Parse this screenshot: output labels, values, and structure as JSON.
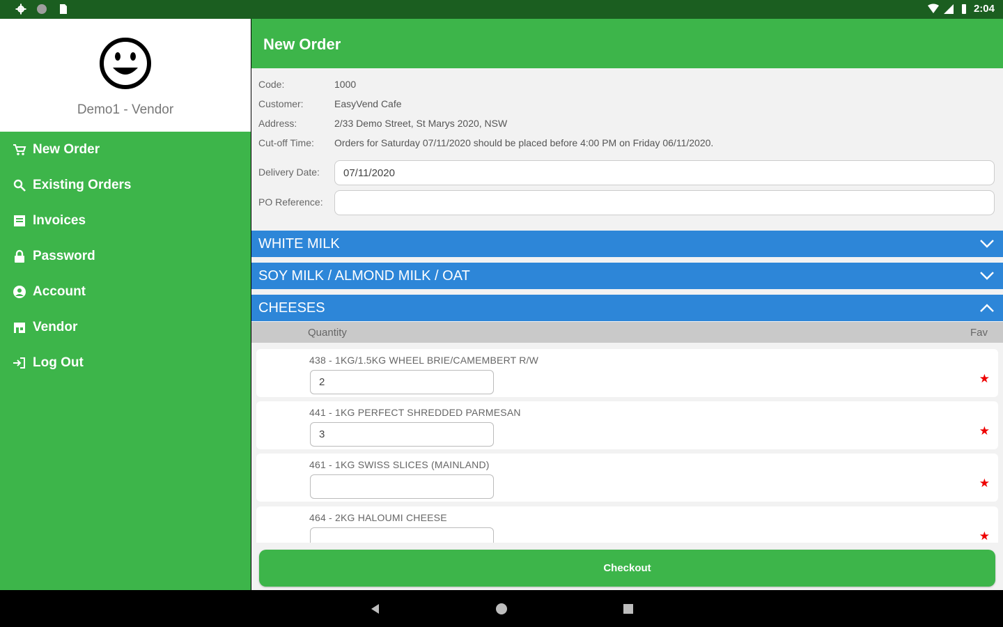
{
  "status_bar": {
    "time": "2:04"
  },
  "sidebar": {
    "profile_name": "Demo1 - Vendor",
    "items": [
      {
        "label": "New Order",
        "icon": "cart-icon"
      },
      {
        "label": "Existing Orders",
        "icon": "search-icon"
      },
      {
        "label": "Invoices",
        "icon": "invoice-icon"
      },
      {
        "label": "Password",
        "icon": "lock-icon"
      },
      {
        "label": "Account",
        "icon": "account-icon"
      },
      {
        "label": "Vendor",
        "icon": "store-icon"
      },
      {
        "label": "Log Out",
        "icon": "logout-icon"
      }
    ]
  },
  "header": {
    "title": "New Order"
  },
  "order_info": {
    "code_label": "Code:",
    "code": "1000",
    "customer_label": "Customer:",
    "customer": "EasyVend Cafe",
    "address_label": "Address:",
    "address": "2/33 Demo Street, St Marys 2020, NSW",
    "cutoff_label": "Cut-off Time:",
    "cutoff": "Orders for Saturday 07/11/2020 should be placed before 4:00 PM on Friday 06/11/2020.",
    "delivery_label": "Delivery Date:",
    "delivery_date": "07/11/2020",
    "po_label": "PO Reference:",
    "po_reference": ""
  },
  "categories": [
    {
      "label": "WHITE MILK",
      "expanded": false
    },
    {
      "label": "SOY MILK / ALMOND MILK / OAT",
      "expanded": false
    },
    {
      "label": "CHEESES",
      "expanded": true
    }
  ],
  "table": {
    "quantity_header": "Quantity",
    "fav_header": "Fav"
  },
  "items": [
    {
      "name": "438 - 1KG/1.5KG WHEEL BRIE/CAMEMBERT R/W",
      "quantity": "2",
      "fav": "★"
    },
    {
      "name": "441 - 1KG PERFECT SHREDDED PARMESAN",
      "quantity": "3",
      "fav": "★"
    },
    {
      "name": "461 - 1KG SWISS SLICES (MAINLAND)",
      "quantity": "",
      "fav": "★"
    },
    {
      "name": "464 - 2KG HALOUMI CHEESE",
      "quantity": "",
      "fav": "★"
    }
  ],
  "checkout_label": "Checkout",
  "colors": {
    "green": "#3db54a",
    "dark_green": "#1b5e20",
    "blue": "#2d86d8",
    "star": "#e00000"
  }
}
